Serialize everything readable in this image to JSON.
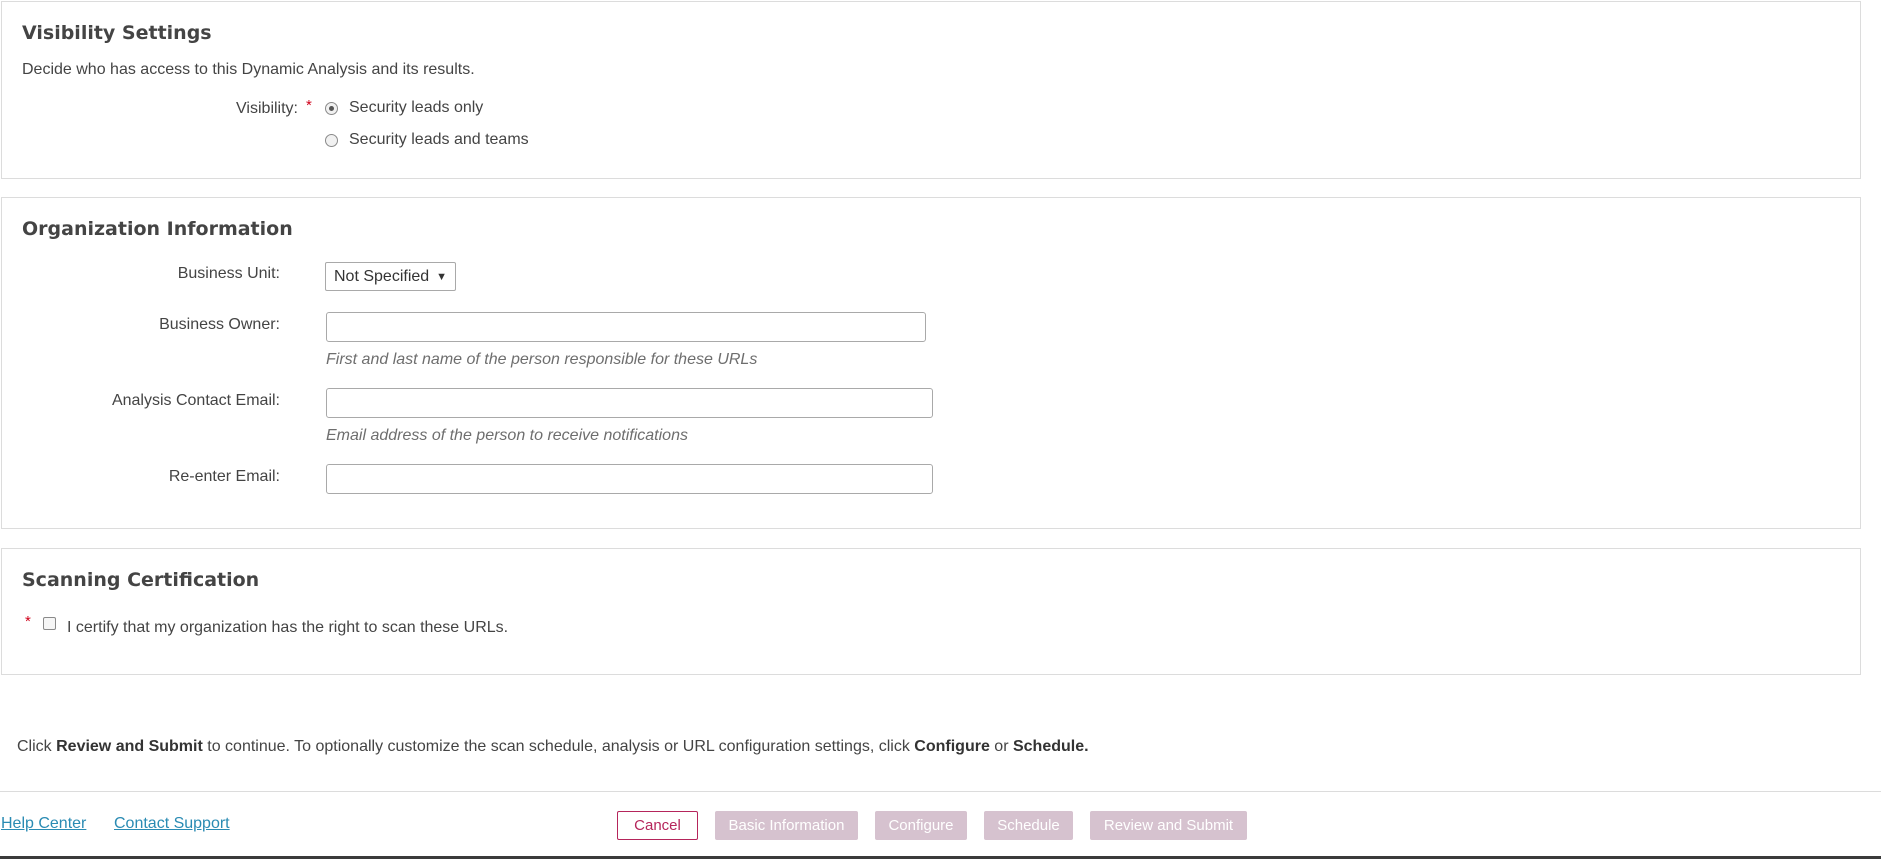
{
  "visibility": {
    "title": "Visibility Settings",
    "description": "Decide who has access to this Dynamic Analysis and its results.",
    "field_label": "Visibility:",
    "required_mark": "*",
    "options": [
      {
        "label": "Security leads only",
        "selected": true
      },
      {
        "label": "Security leads and teams",
        "selected": false
      }
    ]
  },
  "organization": {
    "title": "Organization Information",
    "business_unit": {
      "label": "Business Unit:",
      "value": "Not Specified",
      "chevron_icon": "caret-down-icon"
    },
    "business_owner": {
      "label": "Business Owner:",
      "value": "",
      "hint": "First and last name of the person responsible for these URLs"
    },
    "contact_email": {
      "label": "Analysis Contact Email:",
      "value": "",
      "hint": "Email address of the person to receive notifications"
    },
    "reenter_email": {
      "label": "Re-enter Email:",
      "value": ""
    }
  },
  "certification": {
    "title": "Scanning Certification",
    "required_mark": "*",
    "checkbox_label": "I certify that my organization has the right to scan these URLs.",
    "checked": false
  },
  "instructions": {
    "part1": "Click ",
    "review_submit": "Review and Submit",
    "part2": " to continue. To optionally customize the scan schedule, analysis or URL configuration settings, click ",
    "configure": "Configure",
    "part3": " or ",
    "schedule": "Schedule."
  },
  "footer": {
    "help_center": "Help Center",
    "contact_support": "Contact Support",
    "buttons": {
      "cancel": "Cancel",
      "basic_information": "Basic Information",
      "configure": "Configure",
      "schedule": "Schedule",
      "review_and_submit": "Review and Submit"
    },
    "colors": {
      "accent": "#b5255b",
      "disabled_step": "#d6c2cf",
      "link": "#2a8bb3",
      "required": "#d0021b"
    }
  }
}
